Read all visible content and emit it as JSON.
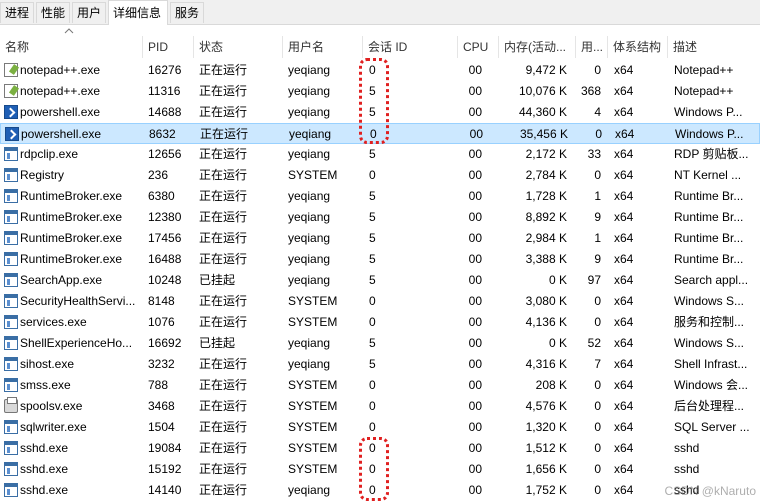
{
  "tabs": [
    "进程",
    "性能",
    "用户",
    "详细信息",
    "服务"
  ],
  "columns": {
    "name": "名称",
    "pid": "PID",
    "status": "状态",
    "user": "用户名",
    "session": "会话 ID",
    "cpu": "CPU",
    "memory": "内存(活动...",
    "handles": "用...",
    "arch": "体系结构",
    "desc": "描述"
  },
  "rows": [
    {
      "icon": "notepad-icon",
      "name": "notepad++.exe",
      "pid": "16276",
      "status": "正在运行",
      "user": "yeqiang",
      "session": "0",
      "cpu": "00",
      "memory": "9,472 K",
      "handles": "0",
      "arch": "x64",
      "desc": "Notepad++"
    },
    {
      "icon": "notepad-icon",
      "name": "notepad++.exe",
      "pid": "11316",
      "status": "正在运行",
      "user": "yeqiang",
      "session": "5",
      "cpu": "00",
      "memory": "10,076 K",
      "handles": "368",
      "arch": "x64",
      "desc": "Notepad++"
    },
    {
      "icon": "powershell-icon",
      "name": "powershell.exe",
      "pid": "14688",
      "status": "正在运行",
      "user": "yeqiang",
      "session": "5",
      "cpu": "00",
      "memory": "44,360 K",
      "handles": "4",
      "arch": "x64",
      "desc": "Windows P..."
    },
    {
      "icon": "powershell-icon",
      "name": "powershell.exe",
      "pid": "8632",
      "status": "正在运行",
      "user": "yeqiang",
      "session": "0",
      "cpu": "00",
      "memory": "35,456 K",
      "handles": "0",
      "arch": "x64",
      "desc": "Windows P...",
      "selected": true
    },
    {
      "icon": "app-icon",
      "name": "rdpclip.exe",
      "pid": "12656",
      "status": "正在运行",
      "user": "yeqiang",
      "session": "5",
      "cpu": "00",
      "memory": "2,172 K",
      "handles": "33",
      "arch": "x64",
      "desc": "RDP 剪贴板..."
    },
    {
      "icon": "app-icon",
      "name": "Registry",
      "pid": "236",
      "status": "正在运行",
      "user": "SYSTEM",
      "session": "0",
      "cpu": "00",
      "memory": "2,784 K",
      "handles": "0",
      "arch": "x64",
      "desc": "NT Kernel ..."
    },
    {
      "icon": "app-icon",
      "name": "RuntimeBroker.exe",
      "pid": "6380",
      "status": "正在运行",
      "user": "yeqiang",
      "session": "5",
      "cpu": "00",
      "memory": "1,728 K",
      "handles": "1",
      "arch": "x64",
      "desc": "Runtime Br..."
    },
    {
      "icon": "app-icon",
      "name": "RuntimeBroker.exe",
      "pid": "12380",
      "status": "正在运行",
      "user": "yeqiang",
      "session": "5",
      "cpu": "00",
      "memory": "8,892 K",
      "handles": "9",
      "arch": "x64",
      "desc": "Runtime Br..."
    },
    {
      "icon": "app-icon",
      "name": "RuntimeBroker.exe",
      "pid": "17456",
      "status": "正在运行",
      "user": "yeqiang",
      "session": "5",
      "cpu": "00",
      "memory": "2,984 K",
      "handles": "1",
      "arch": "x64",
      "desc": "Runtime Br..."
    },
    {
      "icon": "app-icon",
      "name": "RuntimeBroker.exe",
      "pid": "16488",
      "status": "正在运行",
      "user": "yeqiang",
      "session": "5",
      "cpu": "00",
      "memory": "3,388 K",
      "handles": "9",
      "arch": "x64",
      "desc": "Runtime Br..."
    },
    {
      "icon": "app-icon",
      "name": "SearchApp.exe",
      "pid": "10248",
      "status": "已挂起",
      "user": "yeqiang",
      "session": "5",
      "cpu": "00",
      "memory": "0 K",
      "handles": "97",
      "arch": "x64",
      "desc": "Search appl..."
    },
    {
      "icon": "app-icon",
      "name": "SecurityHealthServi...",
      "pid": "8148",
      "status": "正在运行",
      "user": "SYSTEM",
      "session": "0",
      "cpu": "00",
      "memory": "3,080 K",
      "handles": "0",
      "arch": "x64",
      "desc": "Windows S..."
    },
    {
      "icon": "app-icon",
      "name": "services.exe",
      "pid": "1076",
      "status": "正在运行",
      "user": "SYSTEM",
      "session": "0",
      "cpu": "00",
      "memory": "4,136 K",
      "handles": "0",
      "arch": "x64",
      "desc": "服务和控制..."
    },
    {
      "icon": "app-icon",
      "name": "ShellExperienceHo...",
      "pid": "16692",
      "status": "已挂起",
      "user": "yeqiang",
      "session": "5",
      "cpu": "00",
      "memory": "0 K",
      "handles": "52",
      "arch": "x64",
      "desc": "Windows S..."
    },
    {
      "icon": "app-icon",
      "name": "sihost.exe",
      "pid": "3232",
      "status": "正在运行",
      "user": "yeqiang",
      "session": "5",
      "cpu": "00",
      "memory": "4,316 K",
      "handles": "7",
      "arch": "x64",
      "desc": "Shell Infrast..."
    },
    {
      "icon": "app-icon",
      "name": "smss.exe",
      "pid": "788",
      "status": "正在运行",
      "user": "SYSTEM",
      "session": "0",
      "cpu": "00",
      "memory": "208 K",
      "handles": "0",
      "arch": "x64",
      "desc": "Windows 会..."
    },
    {
      "icon": "printer-icon",
      "name": "spoolsv.exe",
      "pid": "3468",
      "status": "正在运行",
      "user": "SYSTEM",
      "session": "0",
      "cpu": "00",
      "memory": "4,576 K",
      "handles": "0",
      "arch": "x64",
      "desc": "后台处理程..."
    },
    {
      "icon": "app-icon",
      "name": "sqlwriter.exe",
      "pid": "1504",
      "status": "正在运行",
      "user": "SYSTEM",
      "session": "0",
      "cpu": "00",
      "memory": "1,320 K",
      "handles": "0",
      "arch": "x64",
      "desc": "SQL Server ..."
    },
    {
      "icon": "app-icon",
      "name": "sshd.exe",
      "pid": "19084",
      "status": "正在运行",
      "user": "SYSTEM",
      "session": "0",
      "cpu": "00",
      "memory": "1,512 K",
      "handles": "0",
      "arch": "x64",
      "desc": "sshd"
    },
    {
      "icon": "app-icon",
      "name": "sshd.exe",
      "pid": "15192",
      "status": "正在运行",
      "user": "SYSTEM",
      "session": "0",
      "cpu": "00",
      "memory": "1,656 K",
      "handles": "0",
      "arch": "x64",
      "desc": "sshd"
    },
    {
      "icon": "app-icon",
      "name": "sshd.exe",
      "pid": "14140",
      "status": "正在运行",
      "user": "yeqiang",
      "session": "0",
      "cpu": "00",
      "memory": "1,752 K",
      "handles": "0",
      "arch": "x64",
      "desc": "sshd"
    }
  ],
  "annotation_color": "#e02020",
  "selection_color": "#cce8ff",
  "watermark": "CSDN @kNaruto"
}
